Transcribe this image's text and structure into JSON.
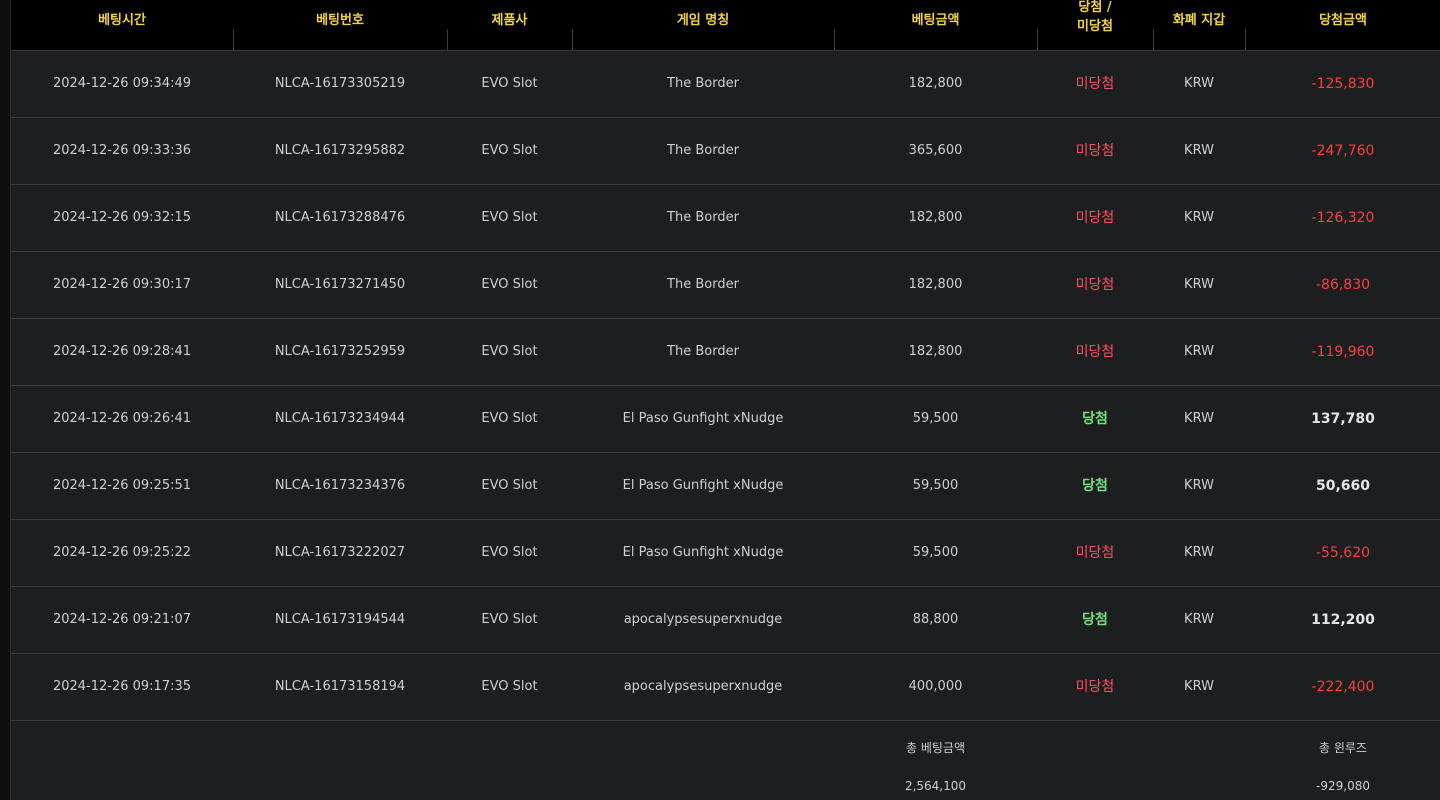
{
  "headers": {
    "bet_time": "베팅시간",
    "bet_number": "베팅번호",
    "provider": "제품사",
    "game_name": "게임 명칭",
    "bet_amount": "베팅금액",
    "result_line1": "당첨 /",
    "result_line2": "미당첨",
    "currency": "화폐 지갑",
    "win_amount": "당첨금액"
  },
  "rows": [
    {
      "time": "2024-12-26 09:34:49",
      "bet_no": "NLCA-16173305219",
      "provider": "EVO Slot",
      "game": "The Border",
      "bet": "182,800",
      "result": "미당첨",
      "win": false,
      "currency": "KRW",
      "amount": "-125,830"
    },
    {
      "time": "2024-12-26 09:33:36",
      "bet_no": "NLCA-16173295882",
      "provider": "EVO Slot",
      "game": "The Border",
      "bet": "365,600",
      "result": "미당첨",
      "win": false,
      "currency": "KRW",
      "amount": "-247,760"
    },
    {
      "time": "2024-12-26 09:32:15",
      "bet_no": "NLCA-16173288476",
      "provider": "EVO Slot",
      "game": "The Border",
      "bet": "182,800",
      "result": "미당첨",
      "win": false,
      "currency": "KRW",
      "amount": "-126,320"
    },
    {
      "time": "2024-12-26 09:30:17",
      "bet_no": "NLCA-16173271450",
      "provider": "EVO Slot",
      "game": "The Border",
      "bet": "182,800",
      "result": "미당첨",
      "win": false,
      "currency": "KRW",
      "amount": "-86,830"
    },
    {
      "time": "2024-12-26 09:28:41",
      "bet_no": "NLCA-16173252959",
      "provider": "EVO Slot",
      "game": "The Border",
      "bet": "182,800",
      "result": "미당첨",
      "win": false,
      "currency": "KRW",
      "amount": "-119,960"
    },
    {
      "time": "2024-12-26 09:26:41",
      "bet_no": "NLCA-16173234944",
      "provider": "EVO Slot",
      "game": "El Paso Gunfight xNudge",
      "bet": "59,500",
      "result": "당첨",
      "win": true,
      "currency": "KRW",
      "amount": "137,780"
    },
    {
      "time": "2024-12-26 09:25:51",
      "bet_no": "NLCA-16173234376",
      "provider": "EVO Slot",
      "game": "El Paso Gunfight xNudge",
      "bet": "59,500",
      "result": "당첨",
      "win": true,
      "currency": "KRW",
      "amount": "50,660"
    },
    {
      "time": "2024-12-26 09:25:22",
      "bet_no": "NLCA-16173222027",
      "provider": "EVO Slot",
      "game": "El Paso Gunfight xNudge",
      "bet": "59,500",
      "result": "미당첨",
      "win": false,
      "currency": "KRW",
      "amount": "-55,620"
    },
    {
      "time": "2024-12-26 09:21:07",
      "bet_no": "NLCA-16173194544",
      "provider": "EVO Slot",
      "game": "apocalypsesuperxnudge",
      "bet": "88,800",
      "result": "당첨",
      "win": true,
      "currency": "KRW",
      "amount": "112,200"
    },
    {
      "time": "2024-12-26 09:17:35",
      "bet_no": "NLCA-16173158194",
      "provider": "EVO Slot",
      "game": "apocalypsesuperxnudge",
      "bet": "400,000",
      "result": "미당첨",
      "win": false,
      "currency": "KRW",
      "amount": "-222,400"
    }
  ],
  "summary": {
    "total_bet_label": "총 베팅금액",
    "total_bet_value": "2,564,100",
    "total_winloss_label": "총 윈루즈",
    "total_winloss_value": "-929,080"
  },
  "colors": {
    "header_text": "#f5d33c",
    "loss_text": "#ff3b3b",
    "win_result_text": "#6fe07b",
    "row_bg": "#1d1e20",
    "header_bg": "#000000"
  }
}
